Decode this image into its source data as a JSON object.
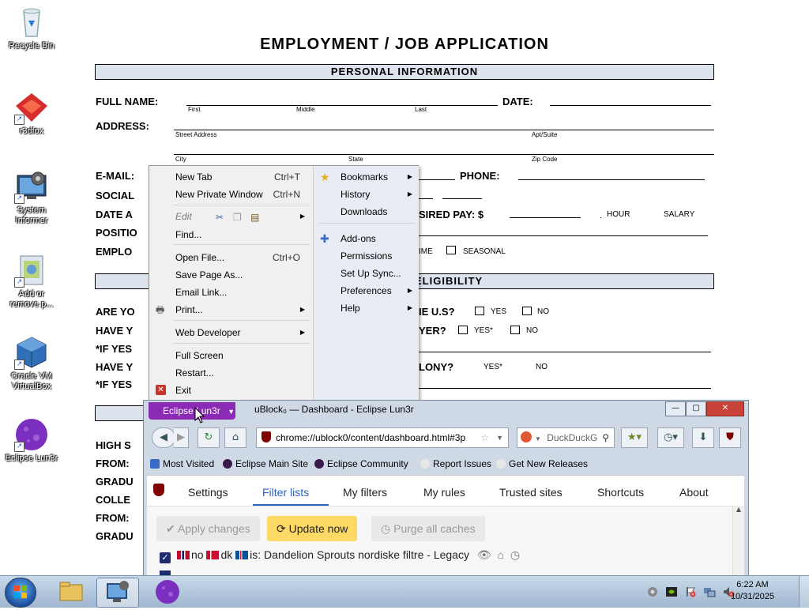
{
  "desktop": {
    "icons": [
      {
        "label": "Recycle Bin",
        "icon": "recycle-bin-icon"
      },
      {
        "label": "r3dfox",
        "icon": "r3dfox-icon"
      },
      {
        "label": "System Informer",
        "icon": "system-informer-icon"
      },
      {
        "label": "Add or remove p...",
        "icon": "add-remove-programs-icon"
      },
      {
        "label": "Oracle VM VirtualBox",
        "icon": "virtualbox-icon"
      },
      {
        "label": "Eclipse Lun3r",
        "icon": "eclipse-lun3r-icon"
      }
    ]
  },
  "form": {
    "title": "EMPLOYMENT / JOB APPLICATION",
    "personal_header": "PERSONAL INFORMATION",
    "full_name": "FULL NAME:",
    "first": "First",
    "middle": "Middle",
    "last": "Last",
    "date": "DATE:",
    "address": "ADDRESS:",
    "street": "Street Address",
    "apt": "Apt/Suite",
    "city": "City",
    "state": "State",
    "zip": "Zip Code",
    "email": "E-MAIL:",
    "phone": "PHONE:",
    "social": "SOCIAL",
    "date_a": "DATE A",
    "desired_pay": "SIRED PAY: $",
    "hour": "HOUR",
    "salary": "SALARY",
    "position": "POSITIO",
    "employ": "EMPLO",
    "time": "IME",
    "seasonal": "SEASONAL",
    "eligibility": "ELIGIBILITY",
    "are_you": "ARE YO",
    "us": "IE U.S?",
    "yes1": "YES",
    "no1": "NO",
    "have_y1": "HAVE Y",
    "yer": "YER?",
    "yes2": "YES*",
    "no2": "NO",
    "if_yes1": "*IF YES",
    "have_y2": "HAVE Y",
    "felony": "LONY?",
    "yes3": "YES*",
    "no3": "NO",
    "if_yes2": "*IF YES",
    "high": "HIGH S",
    "from1": "FROM:",
    "grad1": "GRADU",
    "colle": "COLLE",
    "from2": "FROM:",
    "grad2": "GRADU"
  },
  "menu": {
    "left": [
      {
        "label": "New Tab",
        "shortcut": "Ctrl+T"
      },
      {
        "label": "New Private Window",
        "shortcut": "Ctrl+N"
      },
      {
        "label": "Edit",
        "shortcut": ""
      },
      {
        "label": "Find...",
        "shortcut": ""
      },
      {
        "label": "Open File...",
        "shortcut": "Ctrl+O"
      },
      {
        "label": "Save Page As...",
        "shortcut": ""
      },
      {
        "label": "Email Link...",
        "shortcut": ""
      },
      {
        "label": "Print...",
        "shortcut": ""
      },
      {
        "label": "Web Developer",
        "shortcut": ""
      },
      {
        "label": "Full Screen",
        "shortcut": ""
      },
      {
        "label": "Restart...",
        "shortcut": ""
      },
      {
        "label": "Exit",
        "shortcut": ""
      }
    ],
    "right": [
      {
        "label": "Bookmarks"
      },
      {
        "label": "History"
      },
      {
        "label": "Downloads"
      },
      {
        "label": "Add-ons"
      },
      {
        "label": "Permissions"
      },
      {
        "label": "Set Up Sync..."
      },
      {
        "label": "Preferences"
      },
      {
        "label": "Help"
      }
    ]
  },
  "browser": {
    "app_button": "Eclipse Lun3r",
    "title": "uBlock₀ — Dashboard - Eclipse Lun3r",
    "url": "chrome://ublock0/content/dashboard.html#3p",
    "search_placeholder": "DuckDuckG",
    "bookmarks": [
      "Most Visited",
      "Eclipse Main Site",
      "Eclipse Community",
      "Report Issues",
      "Get New Releases"
    ]
  },
  "ublock": {
    "tabs": [
      "Settings",
      "Filter lists",
      "My filters",
      "My rules",
      "Trusted sites",
      "Shortcuts",
      "About"
    ],
    "active_tab": "Filter lists",
    "apply": "Apply changes",
    "update": "Update now",
    "purge": "Purge all caches",
    "row1_codes": [
      "no",
      "dk",
      "is:"
    ],
    "row1_text": "Dandelion Sprouts nordiske filtre - Legacy"
  },
  "taskbar": {
    "time": "6:22 AM",
    "date": "10/31/2025"
  }
}
